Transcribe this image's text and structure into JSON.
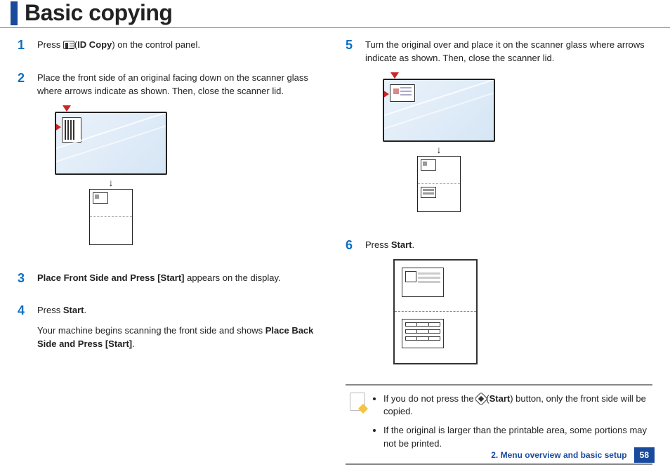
{
  "header": {
    "title": "Basic copying"
  },
  "steps": {
    "s1": {
      "num": "1",
      "a": "Press ",
      "b": "ID Copy",
      "c": ") on the control panel."
    },
    "s2": {
      "num": "2",
      "text": "Place the front side of an original facing down on the scanner glass where arrows indicate as shown. Then, close the scanner lid."
    },
    "s3": {
      "num": "3",
      "a": "Place Front Side and Press [Start]",
      "b": " appears on the display."
    },
    "s4": {
      "num": "4",
      "a": "Press ",
      "b": "Start",
      "c": ".",
      "d": "Your machine begins scanning the front side and shows ",
      "e": "Place Back Side and Press [Start]",
      "f": "."
    },
    "s5": {
      "num": "5",
      "text": "Turn the original over and place it on the scanner glass where arrows indicate as shown. Then, close the scanner lid."
    },
    "s6": {
      "num": "6",
      "a": "Press ",
      "b": "Start",
      "c": "."
    }
  },
  "note": {
    "b1a": "If you do not press the ",
    "b1b": "Start",
    "b1c": ") button, only the front side will be copied.",
    "b2": "If the original is larger than the printable area, some portions may not be printed."
  },
  "footer": {
    "chapter": "2. Menu overview and basic setup",
    "page": "58"
  }
}
